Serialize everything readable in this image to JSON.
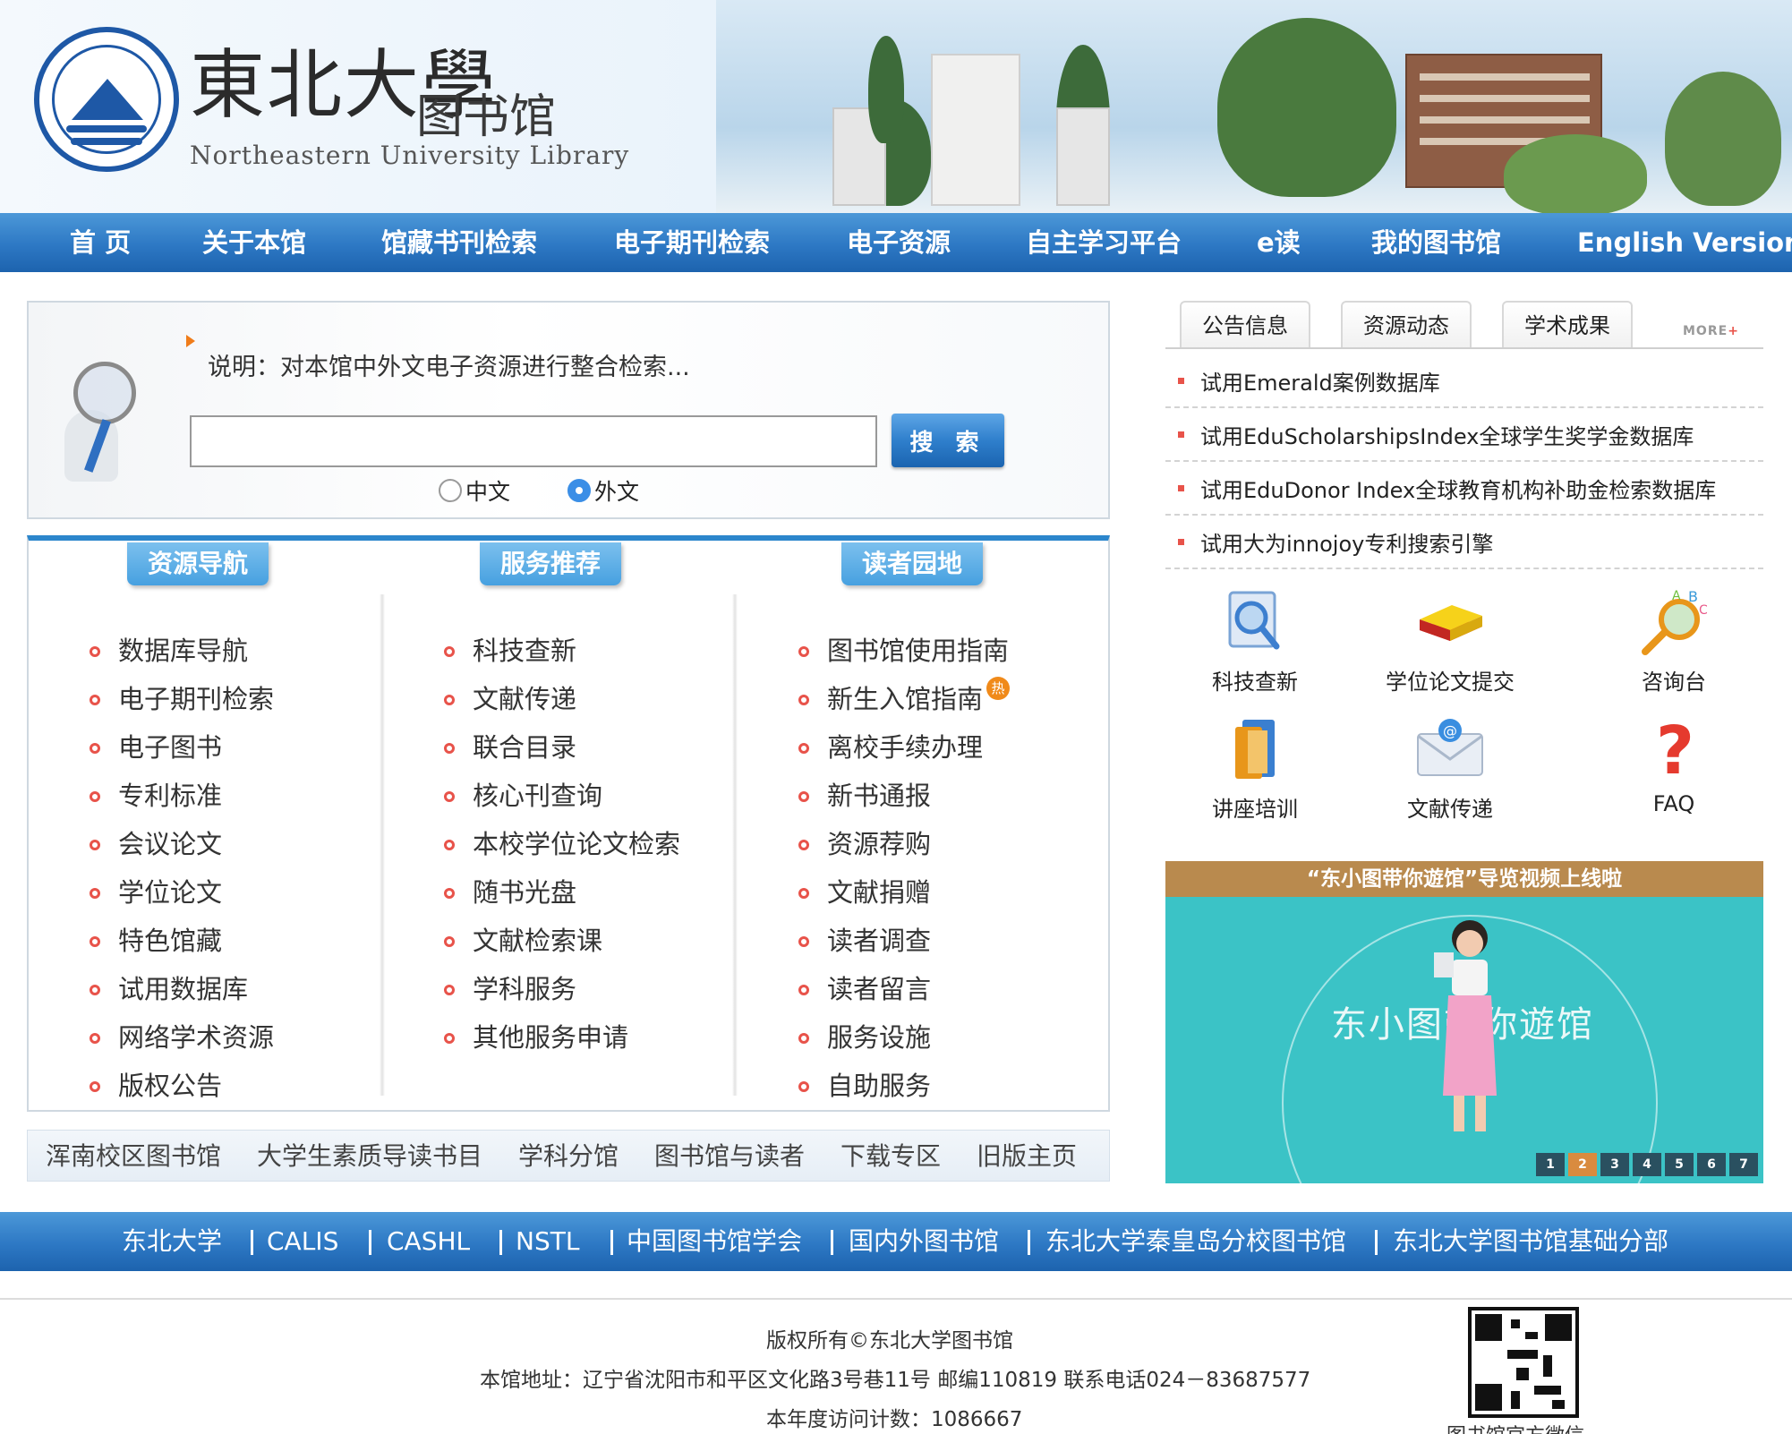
{
  "header": {
    "logo_cn": "東北大學",
    "logo_library": "图书馆",
    "logo_en": "Northeastern University Library"
  },
  "nav": [
    "首 页",
    "关于本馆",
    "馆藏书刊检索",
    "电子期刊检索",
    "电子资源",
    "自主学习平台",
    "e读",
    "我的图书馆",
    "English Version"
  ],
  "search": {
    "tip": "说明：对本馆中外文电子资源进行整合检索...",
    "input_value": "",
    "button_label": "搜 索",
    "options": [
      "中文",
      "外文"
    ],
    "selected": "外文"
  },
  "columns": [
    {
      "title": "资源导航",
      "items": [
        "数据库导航",
        "电子期刊检索",
        "电子图书",
        "专利标准",
        "会议论文",
        "学位论文",
        "特色馆藏",
        "试用数据库",
        "网络学术资源",
        "版权公告"
      ]
    },
    {
      "title": "服务推荐",
      "items": [
        "科技查新",
        "文献传递",
        "联合目录",
        "核心刊查询",
        "本校学位论文检索",
        "随书光盘",
        "文献检索课",
        "学科服务",
        "其他服务申请"
      ]
    },
    {
      "title": "读者园地",
      "items": [
        "图书馆使用指南",
        "新生入馆指南",
        "离校手续办理",
        "新书通报",
        "资源荐购",
        "文献捐赠",
        "读者调查",
        "读者留言",
        "服务设施",
        "自助服务"
      ],
      "hot_badge": "热"
    }
  ],
  "quick_links": [
    "浑南校区图书馆",
    "大学生素质导读书目",
    "学科分馆",
    "图书馆与读者",
    "下载专区",
    "旧版主页"
  ],
  "news": {
    "tabs": [
      "公告信息",
      "资源动态",
      "学术成果"
    ],
    "more_label": "MORE",
    "items": [
      "试用Emerald案例数据库",
      "试用EduScholarshipsIndex全球学生奖学金数据库",
      "试用EduDonor Index全球教育机构补助金检索数据库",
      "试用大为innojoy专利搜索引擎"
    ]
  },
  "quick_icons": [
    {
      "label": "科技查新",
      "icon": "magnifier-document-icon"
    },
    {
      "label": "学位论文提交",
      "icon": "books-icon"
    },
    {
      "label": "咨询台",
      "icon": "abc-magnifier-icon"
    },
    {
      "label": "讲座培训",
      "icon": "folder-icon"
    },
    {
      "label": "文献传递",
      "icon": "email-icon"
    },
    {
      "label": "FAQ",
      "icon": "question-mark-icon"
    }
  ],
  "video": {
    "title": "“东小图带你遊馆”导览视频上线啦",
    "overlay_text": "东小图带你遊馆",
    "pages": [
      "1",
      "2",
      "3",
      "4",
      "5",
      "6",
      "7"
    ],
    "active_page": "2"
  },
  "footer_links": [
    "东北大学",
    "CALIS",
    "CASHL",
    "NSTL",
    "中国图书馆学会",
    "国内外图书馆",
    "东北大学秦皇岛分校图书馆",
    "东北大学图书馆基础分部"
  ],
  "footer": {
    "copyright": "版权所有©东北大学图书馆",
    "address": "本馆地址：辽宁省沈阳市和平区文化路3号巷11号 邮编110819 联系电话024－83687577",
    "visits": "本年度访问计数：1086667",
    "qr_label": "图书馆官方微信"
  },
  "colors": {
    "nav_blue": "#2d78c4",
    "accent_orange": "#f07c1a",
    "bullet_red": "#e8534a",
    "video_teal": "#3bc3c6"
  }
}
